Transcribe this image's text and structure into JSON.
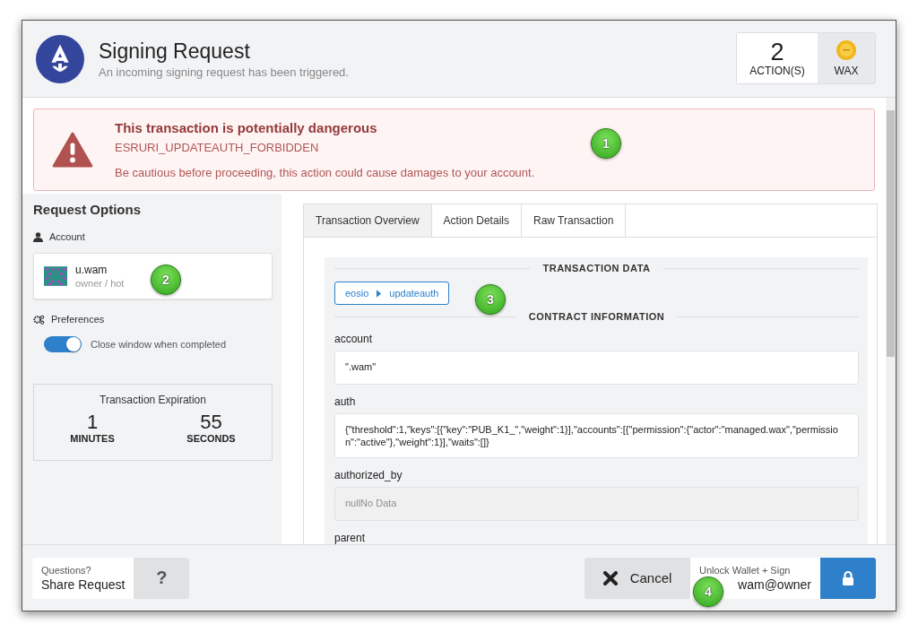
{
  "header": {
    "title": "Signing Request",
    "subtitle": "An incoming signing request has been triggered.",
    "action_count": "2",
    "action_label": "ACTION(S)",
    "chain": "WAX"
  },
  "alert": {
    "title": "This transaction is potentially dangerous",
    "code": "ESRURI_UPDATEAUTH_FORBIDDEN",
    "message": "Be cautious before proceeding, this action could cause damages to your account."
  },
  "request_options": {
    "title": "Request Options",
    "account_heading": "Account",
    "account": {
      "name": "u.wam",
      "permission": "owner / hot"
    },
    "preferences_heading": "Preferences",
    "preferences": [
      {
        "label": "Close window when completed",
        "on": true
      }
    ],
    "expiration": {
      "title": "Transaction Expiration",
      "minutes": "1",
      "minutes_label": "MINUTES",
      "seconds": "55",
      "seconds_label": "SECONDS"
    }
  },
  "tabs": [
    {
      "label": "Transaction Overview",
      "selected": true
    },
    {
      "label": "Action Details",
      "selected": false
    },
    {
      "label": "Raw Transaction",
      "selected": false
    }
  ],
  "transaction_data": {
    "heading": "TRANSACTION DATA",
    "contract": "eosio",
    "action": "updateauth",
    "contract_heading": "CONTRACT INFORMATION",
    "fields": [
      {
        "label": "account",
        "value": "\".wam\""
      },
      {
        "label": "auth",
        "value": "{\"threshold\":1,\"keys\":[{\"key\":\"PUB_K1_\",\"weight\":1}],\"accounts\":[{\"permission\":{\"actor\":\"managed.wax\",\"permission\":\"active\"},\"weight\":1}],\"waits\":[]}"
      },
      {
        "label": "authorized_by",
        "placeholder": "nullNo Data"
      },
      {
        "label": "parent"
      }
    ]
  },
  "footer": {
    "questions": "Questions?",
    "share": "Share Request",
    "help": "?",
    "cancel": "Cancel",
    "sign_caption": "Unlock Wallet + Sign",
    "sign_account": "wam@owner"
  },
  "callouts": [
    "1",
    "2",
    "3",
    "4"
  ]
}
